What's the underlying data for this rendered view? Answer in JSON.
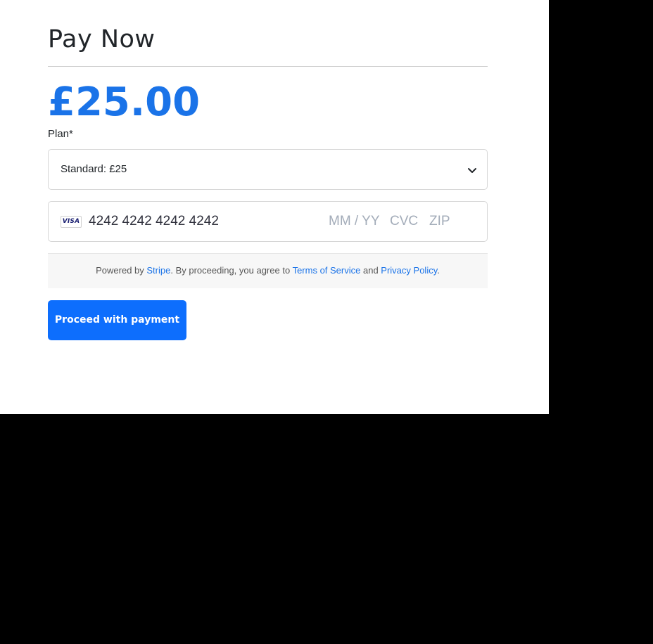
{
  "page": {
    "title": "Pay Now",
    "amount": "£25.00"
  },
  "plan": {
    "label": "Plan*",
    "selected": "Standard: £25"
  },
  "card": {
    "brand": "VISA",
    "number": "4242 4242 4242 4242",
    "expiry_placeholder": "MM / YY",
    "cvc_placeholder": "CVC",
    "zip_placeholder": "ZIP"
  },
  "notice": {
    "prefix": "Powered by ",
    "stripe_link": "Stripe",
    "middle": ". By proceeding, you agree to ",
    "terms_link": "Terms of Service",
    "and": " and ",
    "privacy_link": "Privacy Policy",
    "suffix": "."
  },
  "button": {
    "label": "Proceed with payment"
  },
  "colors": {
    "accent": "#1a73e8",
    "button": "#0d6efd",
    "page_background": "#000000",
    "panel_background": "#ffffff"
  },
  "icons": {
    "card_brand": "visa-card-icon",
    "select_arrow": "chevron-down-icon"
  }
}
